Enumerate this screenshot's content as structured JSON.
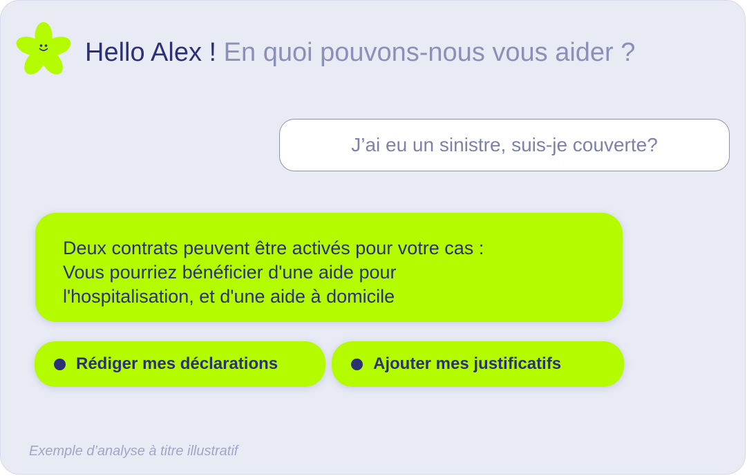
{
  "header": {
    "greeting": "Hello Alex !",
    "question": "En quoi pouvons-nous vous aider ?"
  },
  "mascot": {
    "icon": "smiling-flower-mascot-icon",
    "color": "#b5fb00"
  },
  "conversation": {
    "user_message": "J’ai eu un sinistre, suis-je couverte?",
    "bot_message_lines": [
      "Deux contrats peuvent être activés pour votre cas :",
      "Vous pourriez bénéficier d'une aide pour",
      "l'hospitalisation, et d'une aide à domicile"
    ]
  },
  "actions": [
    {
      "label": "Rédiger mes déclarations",
      "icon": "bullet-dot-icon"
    },
    {
      "label": "Ajouter mes justificatifs",
      "icon": "bullet-dot-icon"
    }
  ],
  "footer": {
    "disclaimer": "Exemple d’analyse à titre illustratif"
  },
  "colors": {
    "accent_green": "#b5fb00",
    "navy_text": "#2b3174",
    "muted_text": "#8c90b8",
    "background": "#e8eaf4"
  }
}
